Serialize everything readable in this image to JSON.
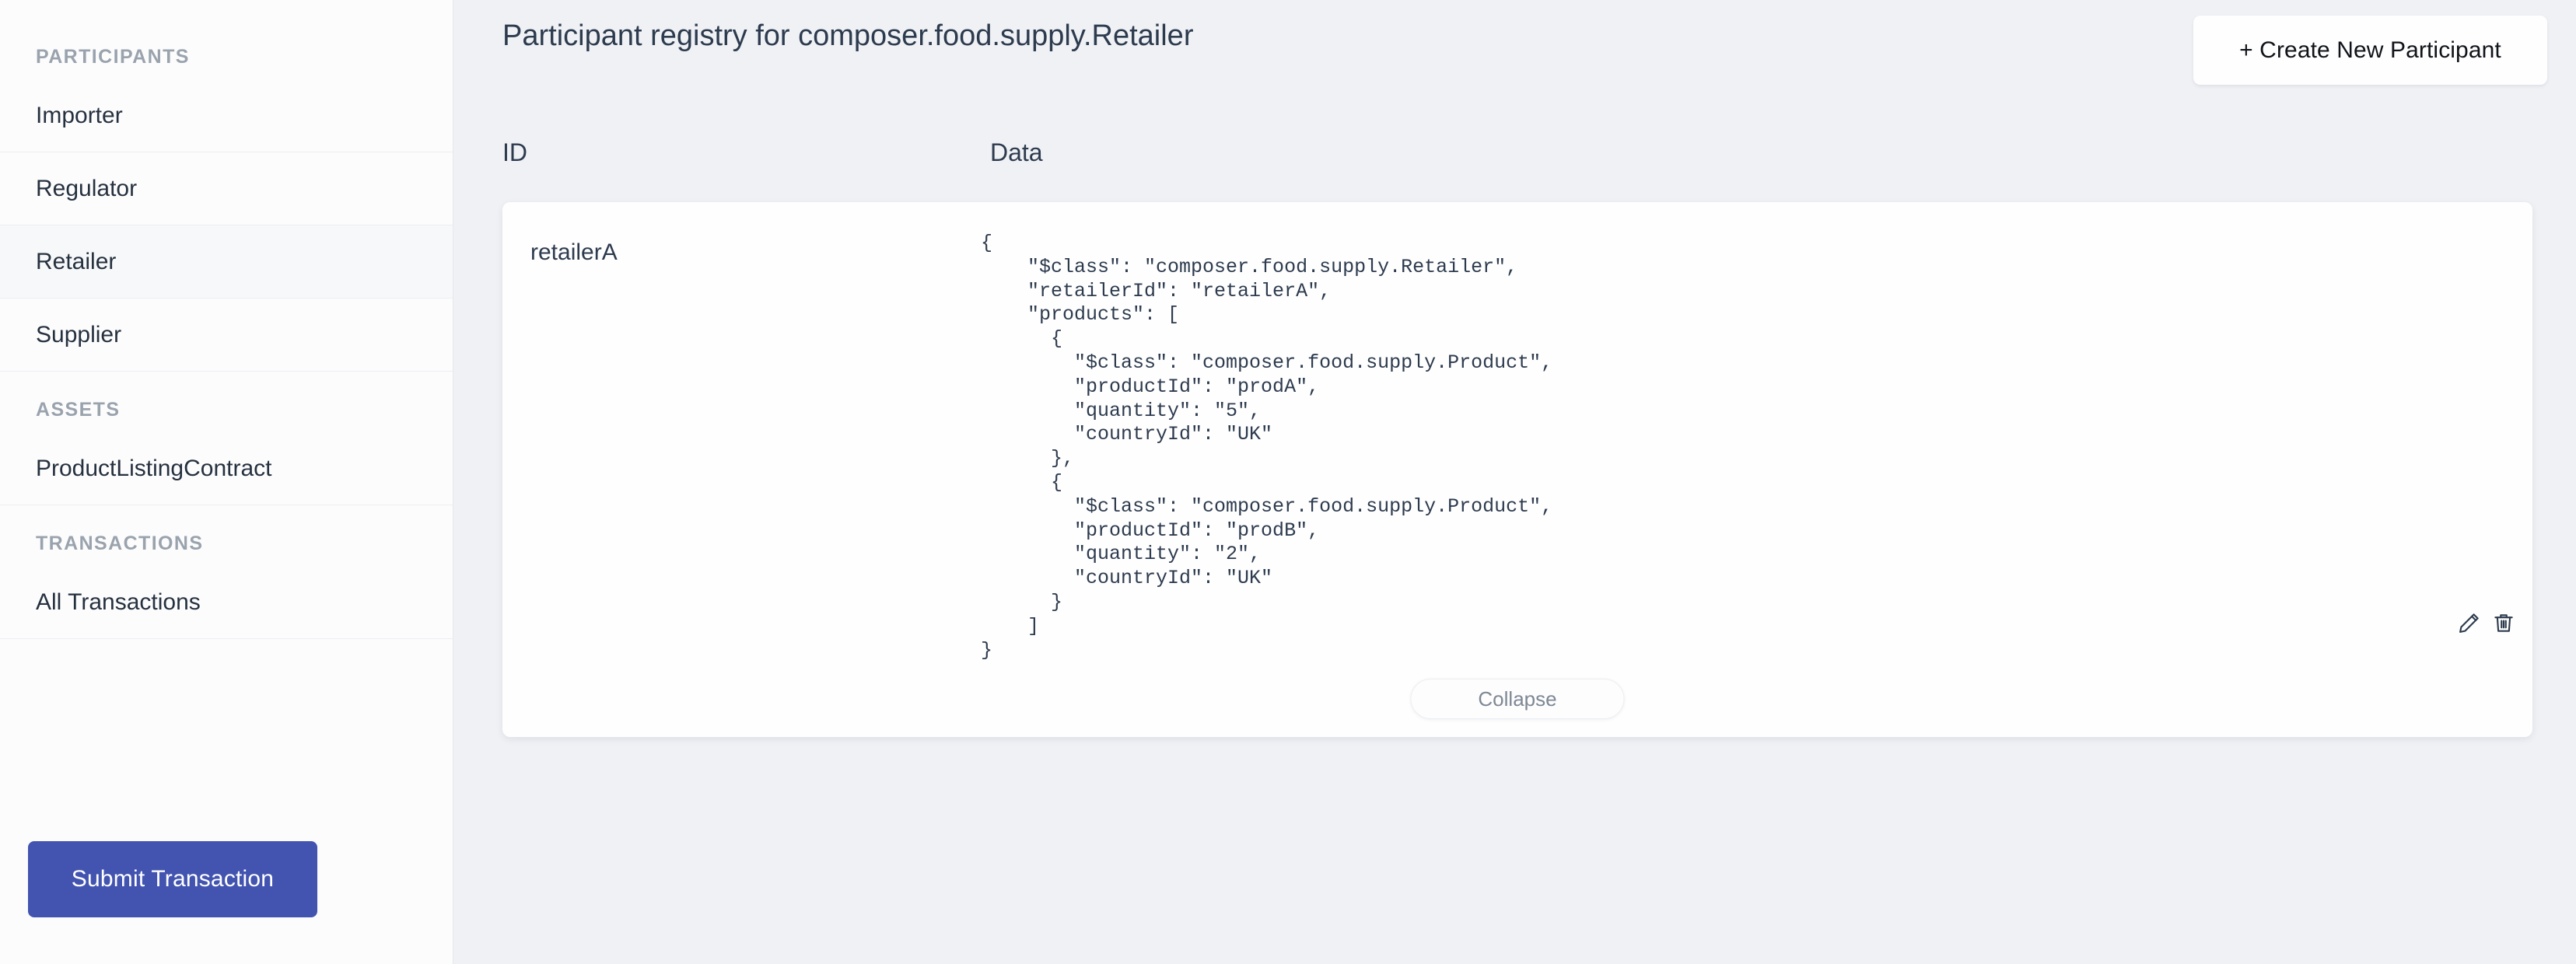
{
  "sidebar": {
    "sections": [
      {
        "title": "PARTICIPANTS",
        "items": [
          {
            "label": "Importer",
            "active": false
          },
          {
            "label": "Regulator",
            "active": false
          },
          {
            "label": "Retailer",
            "active": true
          },
          {
            "label": "Supplier",
            "active": false
          }
        ]
      },
      {
        "title": "ASSETS",
        "items": [
          {
            "label": "ProductListingContract",
            "active": false
          }
        ]
      },
      {
        "title": "TRANSACTIONS",
        "items": [
          {
            "label": "All Transactions",
            "active": false
          }
        ]
      }
    ],
    "submit_button_label": "Submit Transaction"
  },
  "header": {
    "title": "Participant registry for composer.food.supply.Retailer",
    "create_button_label": "+ Create New Participant"
  },
  "table": {
    "columns": {
      "id": "ID",
      "data": "Data"
    },
    "rows": [
      {
        "id": "retailerA",
        "json": "{\n    \"$class\": \"composer.food.supply.Retailer\",\n    \"retailerId\": \"retailerA\",\n    \"products\": [\n      {\n        \"$class\": \"composer.food.supply.Product\",\n        \"productId\": \"prodA\",\n        \"quantity\": \"5\",\n        \"countryId\": \"UK\"\n      },\n      {\n        \"$class\": \"composer.food.supply.Product\",\n        \"productId\": \"prodB\",\n        \"quantity\": \"2\",\n        \"countryId\": \"UK\"\n      }\n    ]\n}",
        "collapse_label": "Collapse",
        "edit_icon": "pencil-icon",
        "delete_icon": "trash-icon"
      }
    ]
  },
  "record_fields": {
    "class": "composer.food.supply.Retailer",
    "retailerId": "retailerA",
    "products": [
      {
        "class": "composer.food.supply.Product",
        "productId": "prodA",
        "quantity": "5",
        "countryId": "UK"
      },
      {
        "class": "composer.food.supply.Product",
        "productId": "prodB",
        "quantity": "2",
        "countryId": "UK"
      }
    ]
  },
  "colors": {
    "accent": "#4254b0",
    "background": "#eff1f5",
    "sidebar": "#fcfcfd",
    "card": "#fefefe",
    "text": "#2d3b4e",
    "muted": "#9aa3ad"
  }
}
